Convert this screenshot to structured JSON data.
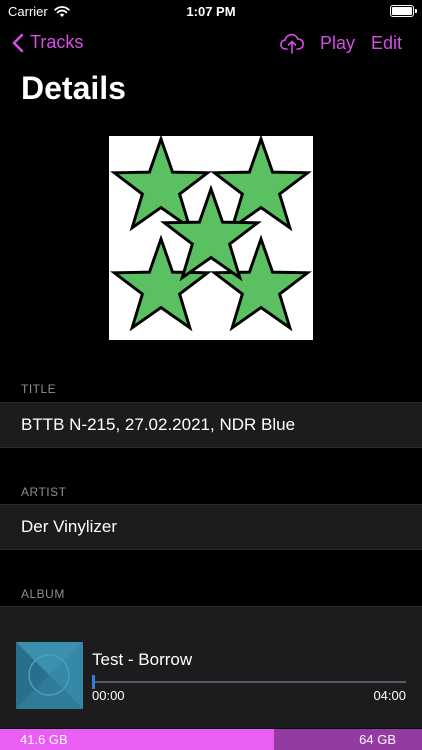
{
  "status_bar": {
    "carrier": "Carrier",
    "time": "1:07 PM"
  },
  "nav": {
    "back_label": "Tracks",
    "play_label": "Play",
    "edit_label": "Edit",
    "accent_color": "#d64ee6"
  },
  "page": {
    "title": "Details"
  },
  "fields": [
    {
      "header": "TITLE",
      "value": "BTTB N-215, 27.02.2021, NDR Blue"
    },
    {
      "header": "ARTIST",
      "value": "Der Vinylizer"
    },
    {
      "header": "ALBUM",
      "value": ""
    }
  ],
  "now_playing": {
    "title": "Test - Borrow",
    "elapsed": "00:00",
    "duration": "04:00",
    "progress_fraction": 0.0
  },
  "storage": {
    "used": "41.6 GB",
    "total": "64 GB",
    "used_color": "#ea5ef5",
    "total_color": "#943ba3"
  },
  "icons": [
    "wifi-icon",
    "battery-icon",
    "chevron-left-icon",
    "cloud-upload-icon",
    "stars-cover-art",
    "album-art-thumbnail"
  ]
}
